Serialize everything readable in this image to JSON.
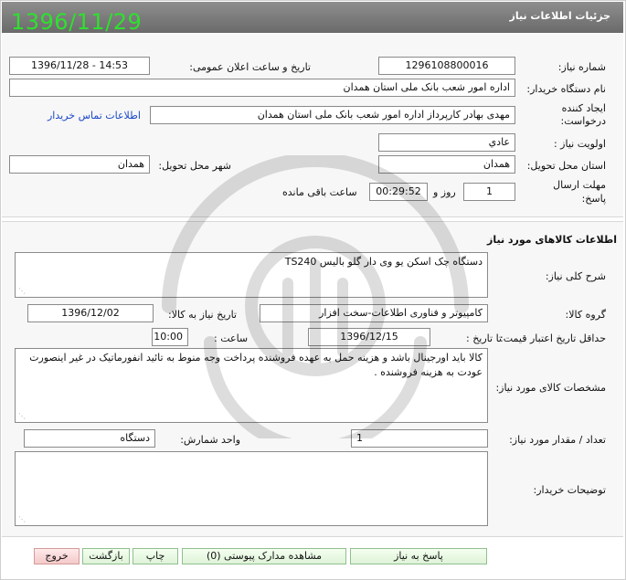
{
  "header": {
    "title": "جزئیات اطلاعات نیاز",
    "date_stamp": "1396/11/29"
  },
  "info": {
    "need_number_label": "شماره نیاز:",
    "need_number": "1296108800016",
    "announce_label": "تاریخ و ساعت اعلان عمومی:",
    "announce_value": "1396/11/28 - 14:53",
    "buyer_label": "نام دستگاه خریدار:",
    "buyer_value": "اداره امور شعب بانک ملی استان همدان",
    "creator_label_1": "ایجاد کننده",
    "creator_label_2": "درخواست:",
    "creator_value": "مهدی بهادر کارپرداز اداره امور شعب بانک ملی استان همدان",
    "contact_link": "اطلاعات تماس خریدار",
    "priority_label": "اولویت نیاز :",
    "priority_value": "عادي",
    "province_label": "استان محل تحویل:",
    "province_value": "همدان",
    "city_label": "شهر محل تحویل:",
    "city_value": "همدان",
    "deadline_label_1": "مهلت ارسال",
    "deadline_label_2": "پاسخ:",
    "days_value": "1",
    "days_suffix": "روز و",
    "time_value": "00:29:52",
    "remaining_suffix": "ساعت باقی مانده"
  },
  "goods": {
    "section_title": "اطلاعات کالاهای مورد نیاز",
    "summary_label": "شرح کلی نیاز:",
    "summary_value": "دستگاه چک اسکن  یو وی دار   گلو بالیس TS240",
    "group_label": "گروه کالا:",
    "group_value": "کامپیوتر و فناوری اطلاعات-سخت افزار",
    "need_date_label": "تاریخ نیاز به کالا:",
    "need_date_value": "1396/12/02",
    "validity_label": "حداقل تاریخ اعتبار قیمت:",
    "until_date_label": "تا تاریخ :",
    "until_date_value": "1396/12/15",
    "hour_label": "ساعت :",
    "hour_value": "10:00",
    "specs_label": "مشخصات کالای مورد نیاز:",
    "specs_value": "کالا باید اورجینال باشد و هزینه حمل به عهده فروشنده پرداخت وجه منوط به تائید انفورماتیک در غیر اینصورت عودت به هزینه فروشنده .",
    "qty_label": "تعداد / مقدار مورد نیاز:",
    "qty_value": "1",
    "unit_label": "واحد شمارش:",
    "unit_value": "دستگاه",
    "buyer_notes_label": "توضیحات خریدار:",
    "buyer_notes_value": ""
  },
  "buttons": {
    "reply": "پاسخ به نیاز",
    "attachments": "مشاهده مدارک پیوستی (0)",
    "print": "چاپ",
    "back": "بازگشت",
    "exit": "خروج"
  }
}
